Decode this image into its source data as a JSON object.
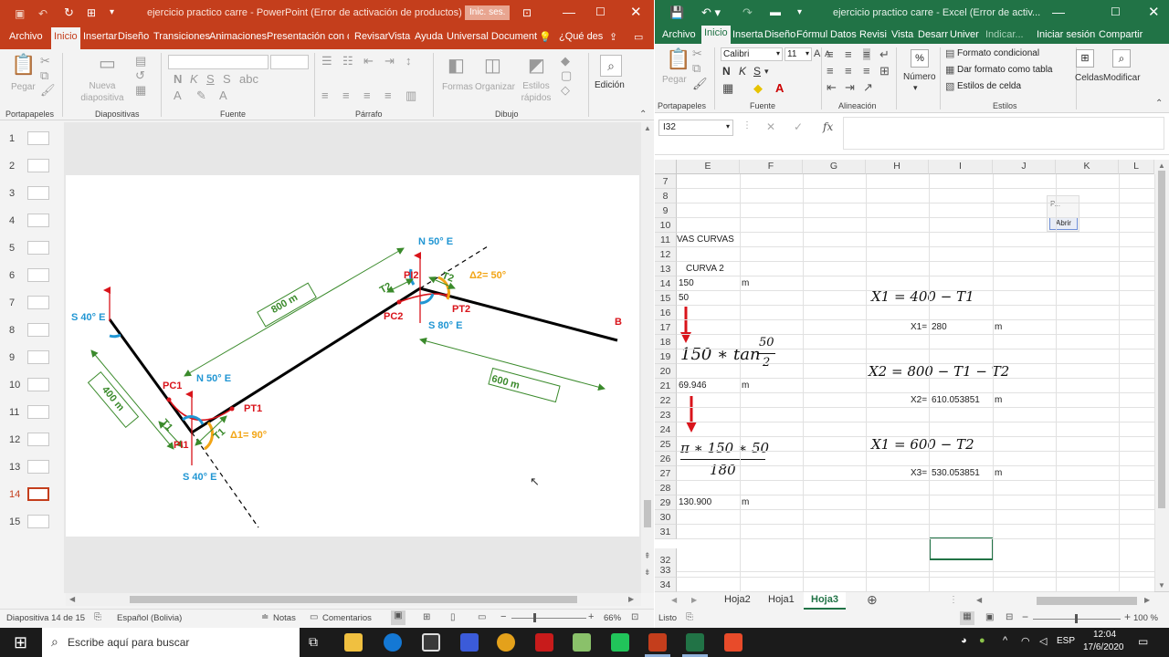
{
  "ppt": {
    "title": "ejercicio practico carre  -  PowerPoint (Error de activación de productos)",
    "signin": "Inic. ses.",
    "tabs": [
      "Archivo",
      "Inicio",
      "Insertar",
      "Diseño",
      "Transiciones",
      "Animaciones",
      "Presentación con di",
      "Revisar",
      "Vista",
      "Ayuda",
      "Universal Document"
    ],
    "tell_me": "¿Qué des",
    "ribbon": {
      "pegar": "Pegar",
      "nueva_diapositiva": "Nueva diapositiva",
      "formas": "Formas",
      "organizar": "Organizar",
      "estilos_rapidos": "Estilos rápidos",
      "edicion": "Edición",
      "groups": {
        "portapapeles": "Portapapeles",
        "diapositivas": "Diapositivas",
        "fuente": "Fuente",
        "parrafo": "Párrafo",
        "dibujo": "Dibujo"
      }
    },
    "slide_numbers": [
      "1",
      "2",
      "3",
      "4",
      "5",
      "6",
      "7",
      "8",
      "9",
      "10",
      "11",
      "12",
      "13",
      "14",
      "15"
    ],
    "active_slide": 14,
    "diagram": {
      "s40e_top": "S 40° E",
      "n50e_mid": "N 50° E",
      "n50e_top": "N 50° E",
      "s80e": "S 80° E",
      "s40e_bottom": "S 40° E",
      "pc1": "PC1",
      "pi1": "PI1",
      "pt1": "PT1",
      "pc2": "PC2",
      "pi2": "PI2",
      "pt2": "PT2",
      "t1a": "T1",
      "t1b": "T1",
      "t2a": "T2",
      "t2b": "T2",
      "delta1": "Δ1= 90°",
      "delta2": "Δ2= 50°",
      "b": "B",
      "d400": "400 m",
      "d800": "800 m",
      "d600": "600 m"
    },
    "status": {
      "slide_info": "Diapositiva 14 de 15",
      "language": "Español (Bolivia)",
      "notes": "Notas",
      "comments": "Comentarios",
      "zoom": "66%"
    }
  },
  "excel": {
    "title": "ejercicio practico carre  -  Excel (Error de activ...",
    "tabs": [
      "Archivo",
      "Inicio",
      "Inserta",
      "Diseño",
      "Fórmul",
      "Datos",
      "Revisi",
      "Vista",
      "Desarr",
      "Univer"
    ],
    "indicar": "Indicar...",
    "iniciar_sesion": "Iniciar sesión",
    "compartir": "Compartir",
    "font_name": "Calibri",
    "font_size": "11",
    "ribbon": {
      "pegar": "Pegar",
      "numero": "Número",
      "formato_condicional": "Formato condicional",
      "dar_formato_tabla": "Dar formato como tabla",
      "estilos_celda": "Estilos de celda",
      "celdas": "Celdas",
      "modificar": "Modificar",
      "groups": {
        "portapapeles": "Portapapeles",
        "fuente": "Fuente",
        "alineacion": "Alineación",
        "estilos": "Estilos"
      }
    },
    "name_box": "I32",
    "fx": "fx",
    "columns": [
      "E",
      "F",
      "G",
      "H",
      "I",
      "J",
      "K",
      "L"
    ],
    "rows": [
      "7",
      "8",
      "9",
      "10",
      "11",
      "12",
      "13",
      "14",
      "15",
      "16",
      "17",
      "18",
      "19",
      "20",
      "21",
      "22",
      "23",
      "24",
      "25",
      "26",
      "27",
      "28",
      "29",
      "30",
      "31",
      "32",
      "33",
      "34"
    ],
    "popup": {
      "label": "P...",
      "button": "Abrir"
    },
    "cells": {
      "r11": "VAS CURVAS",
      "r13": "CURVA 2",
      "r14": "150",
      "r14_unit": "m",
      "r15": "50",
      "r21": "69.946",
      "r21_unit": "m",
      "r29": "130.900",
      "r29_unit": "m",
      "x1_label": "X1=",
      "x1_value": "280",
      "x1_unit": "m",
      "x2_label": "X2=",
      "x2_value": "610.053851",
      "x2_unit": "m",
      "x3_label": "X3=",
      "x3_value": "530.053851",
      "x3_unit": "m"
    },
    "formulas": {
      "f1": "X1 = 400 − T1",
      "f2": "X2 = 800 − T1 − T2",
      "f3": "X1 = 600 − T2",
      "tan_lead": "150 ∗ tan",
      "tan_num": "50",
      "tan_den": "2",
      "arc_num": "π ∗ 150 ∗ 50",
      "arc_den": "180"
    },
    "sheets": [
      "Hoja2",
      "Hoja1",
      "Hoja3"
    ],
    "active_sheet": "Hoja3",
    "status": {
      "ready": "Listo",
      "zoom": "100 %"
    }
  },
  "taskbar": {
    "search": "Escribe aquí para buscar",
    "lang": "ESP",
    "time": "12:04",
    "date": "17/6/2020"
  },
  "colors": {
    "ppt_accent": "#c43e1c",
    "excel_accent": "#217346",
    "diagram_red": "#d9141b",
    "diagram_green": "#3a8a2b",
    "diagram_blue": "#2196d3",
    "diagram_orange": "#f2a516"
  }
}
